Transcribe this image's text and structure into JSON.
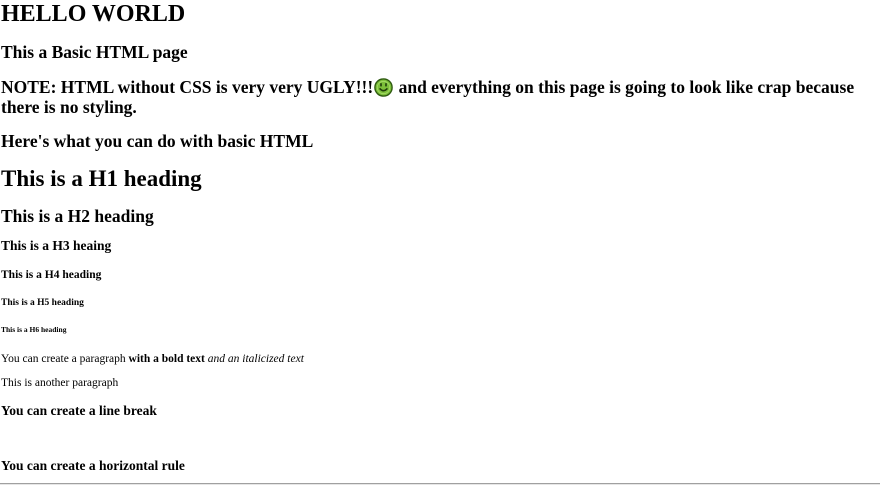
{
  "page": {
    "title": "HELLO WORLD",
    "subtitle": "This a Basic HTML page",
    "note": {
      "before_icon": "NOTE: HTML without CSS is very very UGLY!!!",
      "icon": "green-smiley-icon",
      "after_icon": " and everything on this page is going to look like crap because there is no styling."
    },
    "intro": "Here's what you can do with basic HTML",
    "headings": {
      "h1": "This is a H1 heading",
      "h2": "This is a H2 heading",
      "h3": "This is a H3 heaing",
      "h4": "This is a H4 heading",
      "h5": "This is a H5 heading",
      "h6": "This is a H6 heading"
    },
    "paragraph1": {
      "plain": "You can create a paragraph ",
      "bold": "with a bold text",
      "italic": " and an italicized text"
    },
    "paragraph2": "This is another paragraph",
    "line_break_text": "You can create a line break",
    "horizontal_rule_text": "You can create a horizontal rule"
  },
  "colors": {
    "background": "#ffffff",
    "text": "#000000",
    "smiley_fill": "#7cbf3a",
    "smiley_stroke": "#2e5a10"
  }
}
